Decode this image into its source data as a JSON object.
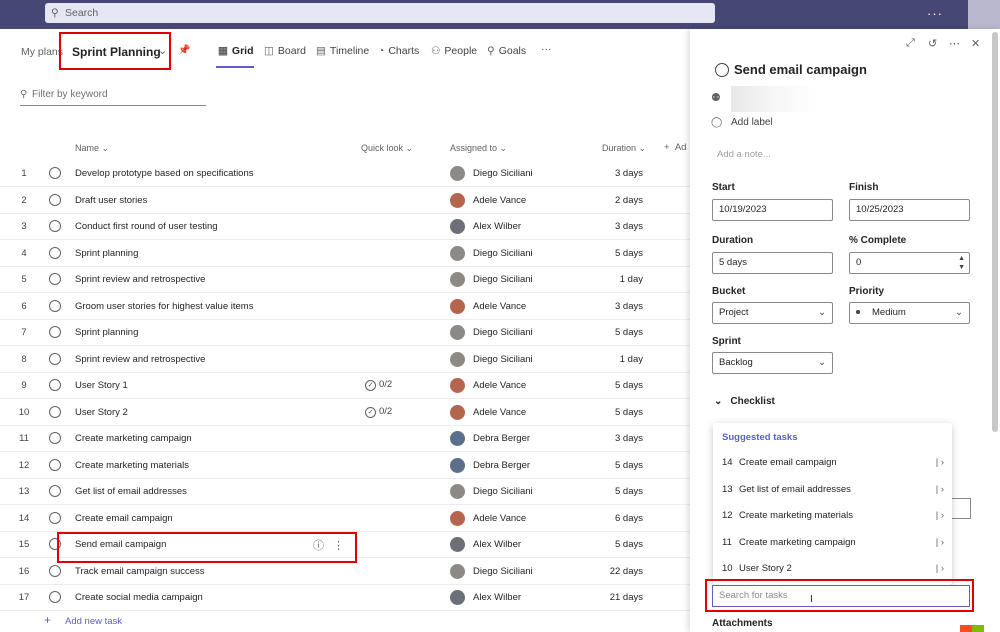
{
  "topbar": {
    "search_placeholder": "Search",
    "more": "···"
  },
  "nav": {
    "crumb": "My plans",
    "plan_title": "Sprint Planning",
    "tabs": [
      {
        "label": "Grid",
        "icon": "grid-icon"
      },
      {
        "label": "Board",
        "icon": "board-icon"
      },
      {
        "label": "Timeline",
        "icon": "timeline-icon"
      },
      {
        "label": "Charts",
        "icon": "charts-icon"
      },
      {
        "label": "People",
        "icon": "people-icon"
      },
      {
        "label": "Goals",
        "icon": "goals-icon"
      }
    ],
    "more": "···"
  },
  "filter": {
    "placeholder": "Filter by keyword"
  },
  "columns": {
    "name": "Name",
    "quick_look": "Quick look",
    "assigned": "Assigned to",
    "duration": "Duration",
    "add": "Ad"
  },
  "rows": [
    {
      "num": "1",
      "name": "Develop prototype based on specifications",
      "quick": "",
      "assignee": "Diego Siciliani",
      "duration": "3 days"
    },
    {
      "num": "2",
      "name": "Draft user stories",
      "quick": "",
      "assignee": "Adele Vance",
      "duration": "2 days"
    },
    {
      "num": "3",
      "name": "Conduct first round of user testing",
      "quick": "",
      "assignee": "Alex Wilber",
      "duration": "3 days"
    },
    {
      "num": "4",
      "name": "Sprint planning",
      "quick": "",
      "assignee": "Diego Siciliani",
      "duration": "5 days"
    },
    {
      "num": "5",
      "name": "Sprint review and retrospective",
      "quick": "",
      "assignee": "Diego Siciliani",
      "duration": "1 day"
    },
    {
      "num": "6",
      "name": "Groom user stories for highest value items",
      "quick": "",
      "assignee": "Adele Vance",
      "duration": "3 days"
    },
    {
      "num": "7",
      "name": "Sprint planning",
      "quick": "",
      "assignee": "Diego Siciliani",
      "duration": "5 days"
    },
    {
      "num": "8",
      "name": "Sprint review and retrospective",
      "quick": "",
      "assignee": "Diego Siciliani",
      "duration": "1 day"
    },
    {
      "num": "9",
      "name": "User Story 1",
      "quick": "0/2",
      "assignee": "Adele Vance",
      "duration": "5 days"
    },
    {
      "num": "10",
      "name": "User Story 2",
      "quick": "0/2",
      "assignee": "Adele Vance",
      "duration": "5 days"
    },
    {
      "num": "11",
      "name": "Create marketing campaign",
      "quick": "",
      "assignee": "Debra Berger",
      "duration": "3 days"
    },
    {
      "num": "12",
      "name": "Create marketing materials",
      "quick": "",
      "assignee": "Debra Berger",
      "duration": "5 days"
    },
    {
      "num": "13",
      "name": "Get list of email addresses",
      "quick": "",
      "assignee": "Diego Siciliani",
      "duration": "5 days"
    },
    {
      "num": "14",
      "name": "Create email campaign",
      "quick": "",
      "assignee": "Adele Vance",
      "duration": "6 days"
    },
    {
      "num": "15",
      "name": "Send email campaign",
      "quick": "",
      "assignee": "Alex Wilber",
      "duration": "5 days"
    },
    {
      "num": "16",
      "name": "Track email campaign success",
      "quick": "",
      "assignee": "Diego Siciliani",
      "duration": "22 days"
    },
    {
      "num": "17",
      "name": "Create social media campaign",
      "quick": "",
      "assignee": "Alex Wilber",
      "duration": "21 days"
    }
  ],
  "add_task": "Add new task",
  "avatar_colors": {
    "Diego Siciliani": "#8d8a86",
    "Adele Vance": "#b5654d",
    "Alex Wilber": "#6b6f78",
    "Debra Berger": "#5b6f8c"
  },
  "panel": {
    "title": "Send email campaign",
    "add_label": "Add label",
    "note_placeholder": "Add a note...",
    "start_label": "Start",
    "start_value": "10/19/2023",
    "finish_label": "Finish",
    "finish_value": "10/25/2023",
    "duration_label": "Duration",
    "duration_value": "5 days",
    "complete_label": "% Complete",
    "complete_value": "0",
    "bucket_label": "Bucket",
    "bucket_value": "Project",
    "priority_label": "Priority",
    "priority_value": "Medium",
    "sprint_label": "Sprint",
    "sprint_value": "Backlog",
    "checklist_label": "Checklist",
    "suggested_header": "Suggested tasks",
    "suggested": [
      {
        "num": "14",
        "name": "Create email campaign"
      },
      {
        "num": "13",
        "name": "Get list of email addresses"
      },
      {
        "num": "12",
        "name": "Create marketing materials"
      },
      {
        "num": "11",
        "name": "Create marketing campaign"
      },
      {
        "num": "10",
        "name": "User Story 2"
      }
    ],
    "search_tasks_placeholder": "Search for tasks",
    "attachments_label": "Attachments"
  },
  "colors": {
    "topbar": "#464775",
    "accent": "#5b5fc7",
    "highlight": "#e00000"
  }
}
